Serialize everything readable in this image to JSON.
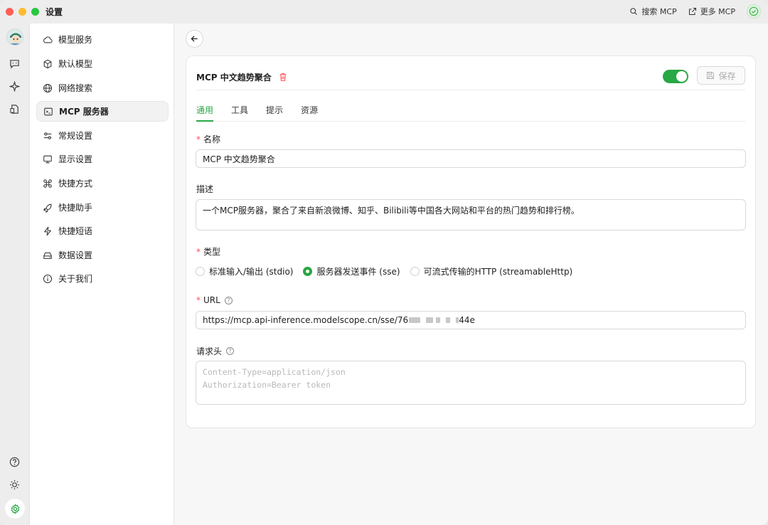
{
  "window": {
    "title": "设置"
  },
  "titlebar": {
    "search_mcp": "搜索 MCP",
    "more_mcp": "更多 MCP"
  },
  "sidebar": {
    "items": [
      {
        "label": "模型服务",
        "icon": "cloud-icon"
      },
      {
        "label": "默认模型",
        "icon": "cube-icon"
      },
      {
        "label": "网络搜索",
        "icon": "globe-icon"
      },
      {
        "label": "MCP 服务器",
        "icon": "terminal-icon",
        "active": true
      },
      {
        "label": "常规设置",
        "icon": "sliders-icon"
      },
      {
        "label": "显示设置",
        "icon": "monitor-icon"
      },
      {
        "label": "快捷方式",
        "icon": "command-icon"
      },
      {
        "label": "快捷助手",
        "icon": "rocket-icon"
      },
      {
        "label": "快捷短语",
        "icon": "zap-icon"
      },
      {
        "label": "数据设置",
        "icon": "drive-icon"
      },
      {
        "label": "关于我们",
        "icon": "info-icon"
      }
    ]
  },
  "server": {
    "title": "MCP 中文趋势聚合",
    "save_label": "保存",
    "enabled": true,
    "tabs": [
      "通用",
      "工具",
      "提示",
      "资源"
    ],
    "active_tab": "通用"
  },
  "form": {
    "name_label": "名称",
    "name_value": "MCP 中文趋势聚合",
    "desc_label": "描述",
    "desc_value": "一个MCP服务器，聚合了来自新浪微博、知乎、Bilibili等中国各大网站和平台的热门趋势和排行榜。",
    "type_label": "类型",
    "type_options": [
      "标准输入/输出 (stdio)",
      "服务器发送事件 (sse)",
      "可流式传输的HTTP (streamableHttp)"
    ],
    "type_selected": "服务器发送事件 (sse)",
    "url_label": "URL",
    "url_prefix": "https://mcp.api-inference.modelscope.cn/sse/76",
    "url_suffix": "44e",
    "headers_label": "请求头",
    "headers_placeholder_1": "Content-Type=application/json",
    "headers_placeholder_2": "Authorization=Bearer token"
  },
  "colors": {
    "accent": "#28a745",
    "danger": "#ff4d4f"
  }
}
